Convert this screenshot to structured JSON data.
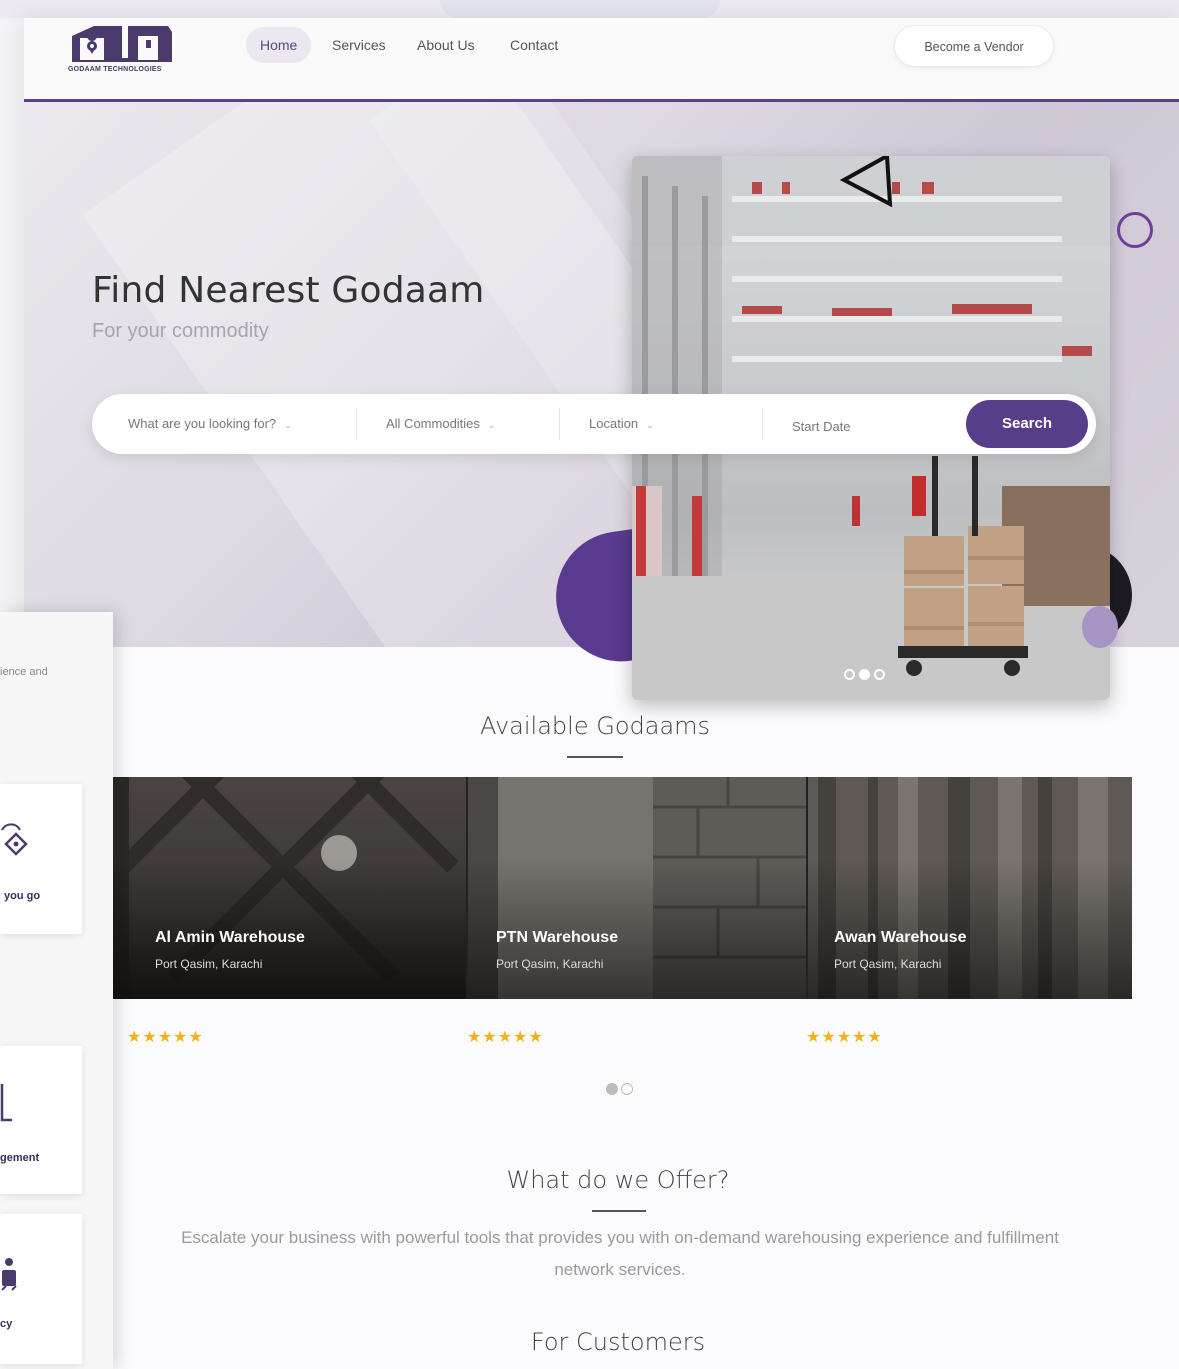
{
  "brand": {
    "logo_text": "GODAAM TECHNOLOGIES",
    "accent": "#573e8a",
    "star_color": "#f0b21b"
  },
  "nav": {
    "items": [
      {
        "label": "Home",
        "active": true
      },
      {
        "label": "Services",
        "active": false
      },
      {
        "label": "About Us",
        "active": false
      },
      {
        "label": "Contact",
        "active": false
      }
    ],
    "vendor_button": "Become a Vendor"
  },
  "hero": {
    "title": "Find Nearest Godaam",
    "subtitle": "For your commodity",
    "slider": {
      "slides": 3,
      "active": 2
    }
  },
  "search": {
    "what_placeholder": "What are you looking for?",
    "commodities": "All Commodities",
    "location": "Location",
    "start_date": "Start Date",
    "button": "Search"
  },
  "godaams": {
    "title": "Available Godaams",
    "items": [
      {
        "name": "Al Amin Warehouse",
        "location": "Port Qasim, Karachi",
        "stars": "★★★★★"
      },
      {
        "name": "PTN Warehouse",
        "location": "Port Qasim, Karachi",
        "stars": "★★★★★"
      },
      {
        "name": "Awan Warehouse",
        "location": "Port Qasim, Karachi",
        "stars": "★★★★★"
      }
    ],
    "pages": 2,
    "active_page": 1
  },
  "offer": {
    "title": "What do we Offer?",
    "description": "Escalate your business with powerful tools that provides you with on-demand warehousing experience and fulfillment network services.",
    "for_customers": "For Customers"
  },
  "left_panel": {
    "fragment_top": "ience and",
    "card1_label": "you go",
    "card2_label": "gement",
    "card3_label": "cy"
  }
}
